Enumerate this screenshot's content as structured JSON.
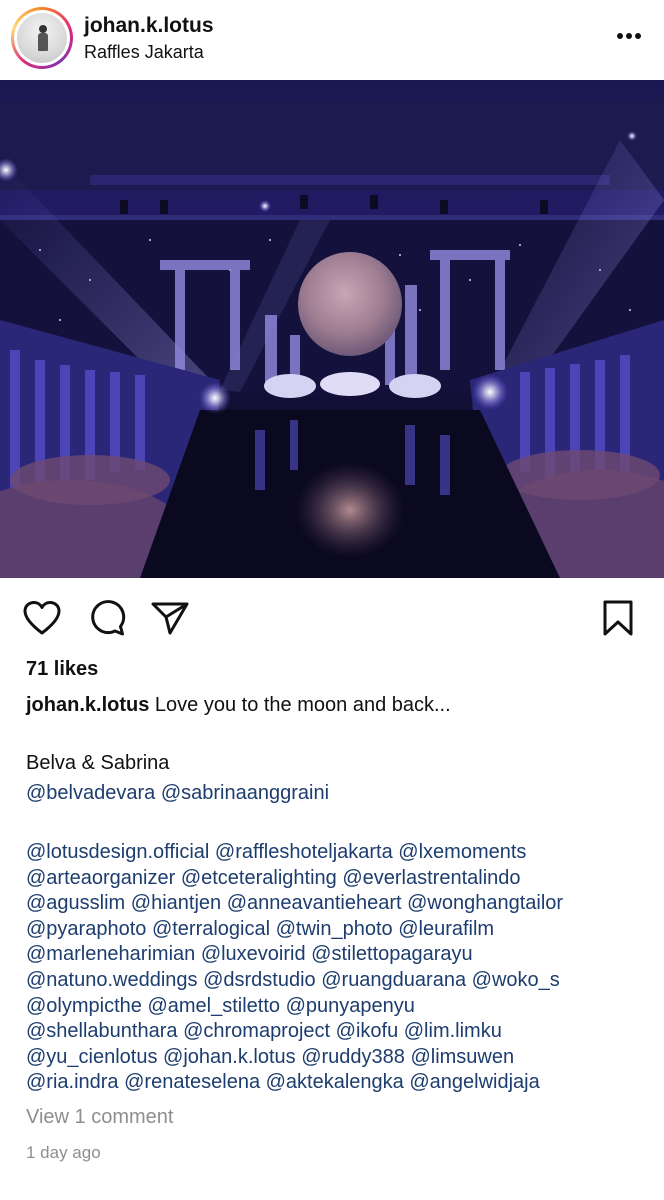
{
  "post": {
    "username": "johan.k.lotus",
    "location": "Raffles Jakarta",
    "likes": "71 likes",
    "caption": "Love you to the moon and back...",
    "couple": "Belva & Sabrina",
    "couple_mentions": "@belvadevara @sabrinaanggraini",
    "credit_lines": [
      "@lotusdesign.official @raffleshoteljakarta @lxemoments",
      "@arteaorganizer @etceteralighting @everlastrentalindo",
      "@agusslim @hiantjen @anneavantieheart @wonghangtailor",
      "@pyaraphoto @terralogical @twin_photo @leurafilm",
      "@marleneharimian @luxevoirid @stilettopagarayu",
      "@natuno.weddings @dsrdstudio @ruangduarana @woko_s",
      "@olympicthe @amel_stiletto @punyapenyu",
      "@shellabunthara @chromaproject @ikofu @lim.limku",
      "@yu_cienlotus @johan.k.lotus @ruddy388 @limsuwen",
      "@ria.indra @renateselena @aktekalengka @angelwidjaja"
    ],
    "view_comments": "View 1 comment",
    "time_ago": "1 day ago"
  },
  "icons": {
    "more": "more-options-icon",
    "like": "heart-icon",
    "comment": "comment-icon",
    "share": "send-icon",
    "save": "bookmark-icon"
  },
  "colors": {
    "mention": "#1d3d6e",
    "muted": "#8e8e8e",
    "text": "#111111"
  }
}
